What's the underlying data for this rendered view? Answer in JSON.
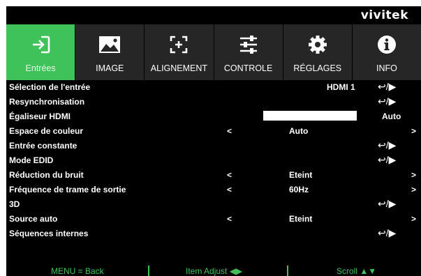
{
  "brand": "vivitek",
  "tabs": [
    {
      "label": "Entrées",
      "icon": "input-icon"
    },
    {
      "label": "IMAGE",
      "icon": "image-icon"
    },
    {
      "label": "ALIGNEMENT",
      "icon": "alignment-icon"
    },
    {
      "label": "CONTROLE",
      "icon": "sliders-icon"
    },
    {
      "label": "RÉGLAGES",
      "icon": "gear-icon"
    },
    {
      "label": "INFO",
      "icon": "info-icon"
    }
  ],
  "active_tab": "Entrées",
  "rows": {
    "r0": {
      "label": "Sélection de l'entrée",
      "value": "HDMI 1",
      "enter": "↩/▶"
    },
    "r1": {
      "label": "Resynchronisation",
      "enter": "↩/▶"
    },
    "r2": {
      "label": "Égaliseur HDMI",
      "value": "Auto"
    },
    "r3": {
      "label": "Espace de couleur",
      "left": "<",
      "value": "Auto",
      "right": ">"
    },
    "r4": {
      "label": "Entrée constante",
      "enter": "↩/▶"
    },
    "r5": {
      "label": "Mode EDID",
      "enter": "↩/▶"
    },
    "r6": {
      "label": "Réduction du bruit",
      "left": "<",
      "value": "Eteint",
      "right": ">"
    },
    "r7": {
      "label": "Fréquence de trame de sortie",
      "left": "<",
      "value": "60Hz",
      "right": ">"
    },
    "r8": {
      "label": "3D",
      "enter": "↩/▶"
    },
    "r9": {
      "label": "Source auto",
      "left": "<",
      "value": "Eteint",
      "right": ">"
    },
    "r10": {
      "label": "Séquences internes",
      "enter": "↩/▶"
    }
  },
  "footer": {
    "back": "MENU = Back",
    "adjust": "Item Adjust ◀▶",
    "scroll": "Scroll ▲▼"
  },
  "colors": {
    "accent": "#3fc25a",
    "tab_bg": "#262626",
    "background": "#000000"
  }
}
